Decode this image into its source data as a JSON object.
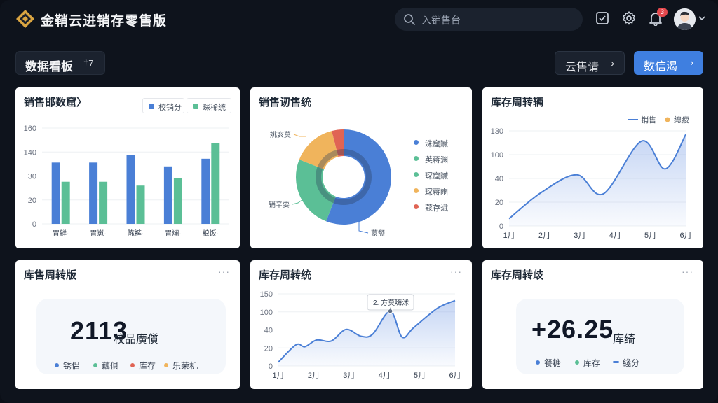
{
  "header": {
    "app_title": "金鞘云进销存零售版",
    "search_placeholder": "入销售台",
    "notification_badge": "3",
    "icons": [
      "logo-icon",
      "search-icon",
      "task-icon",
      "gear-icon",
      "bell-icon",
      "avatar",
      "chevron-down-icon"
    ]
  },
  "toolbar": {
    "board_title": "数据看板",
    "board_count": "†7",
    "btn_secondary": "云售请",
    "btn_primary": "数信渴",
    "arrow": "›"
  },
  "colors": {
    "blue": "#4a7fd6",
    "green": "#5bbf96",
    "orange": "#f0b45c",
    "red": "#e06454",
    "bg": "#0e131c",
    "primary_btn": "#3f7fe0"
  },
  "cards": {
    "sales_bar": {
      "title": "销售邯数窟〉",
      "legend": [
        "校销分",
        "琛稀统"
      ]
    },
    "sales_pie": {
      "title": "销售讱售统",
      "outside_labels": [
        "姚亥莫",
        "销辛要",
        "蒙颓"
      ],
      "legend": [
        "洙窟贓",
        "荚蒋渊",
        "琛窟贓",
        "琛蒋豳",
        "蔻存斌"
      ]
    },
    "stock_line1": {
      "title": "库存周转辆",
      "legend": [
        "销售",
        "總疲"
      ]
    },
    "stock_kpi1": {
      "title": "库售周转版",
      "value": "2113",
      "unit": "校品廣儨",
      "legend": [
        "锈侣",
        "藕俱",
        "库存",
        "乐荣机"
      ]
    },
    "stock_line2": {
      "title": "库存周转统",
      "more": "···",
      "tooltip": "2. 方莫嗨沭"
    },
    "stock_kpi2": {
      "title": "库存周转歧",
      "more": "···",
      "value": "+26.25",
      "unit": "库绮",
      "legend": [
        "餐糖",
        "库存",
        "綫分"
      ]
    }
  },
  "chart_data": [
    {
      "type": "bar",
      "title": "销售邯数窟〉",
      "categories": [
        "胃鲜·",
        "胃崽·",
        "陈裤·",
        "胃斓·",
        "粮饭·"
      ],
      "series": [
        {
          "name": "校销分",
          "values": [
            32,
            32,
            36,
            30,
            34
          ]
        },
        {
          "name": "琛稀统",
          "values": [
            22,
            22,
            20,
            24,
            42
          ]
        }
      ],
      "y_ticks": [
        "0",
        "20",
        "30",
        "140",
        "160"
      ],
      "ylim": [
        0,
        50
      ]
    },
    {
      "type": "pie",
      "title": "销售讱售统",
      "donut": true,
      "slices": [
        {
          "name": "洙窟贓",
          "value": 56
        },
        {
          "name": "荚蒋渊",
          "value": 25
        },
        {
          "name": "琛窟贓",
          "value": 0
        },
        {
          "name": "琛蒋豳",
          "value": 15
        },
        {
          "name": "蔻存斌",
          "value": 4
        }
      ]
    },
    {
      "type": "area",
      "title": "库存周转辆",
      "x": [
        "1月",
        "2月",
        "3月",
        "4月",
        "5月",
        "6月"
      ],
      "y_ticks": [
        "0",
        "20",
        "40",
        "100",
        "130"
      ],
      "ylim": [
        0,
        130
      ],
      "series": [
        {
          "name": "销售",
          "values": [
            10,
            46,
            70,
            44,
            116,
            78,
            125
          ],
          "x_pos": [
            0,
            1.1,
            2.3,
            3.2,
            4.5,
            5.3,
            6
          ]
        }
      ]
    },
    {
      "type": "area",
      "title": "库存周转统",
      "x": [
        "1月",
        "2月",
        "3月",
        "4月",
        "5月",
        "6月"
      ],
      "y_ticks": [
        "0",
        "20",
        "40",
        "100",
        "150"
      ],
      "ylim": [
        0,
        150
      ],
      "series": [
        {
          "values": [
            8,
            44,
            40,
            54,
            52,
            76,
            62,
            66,
            114,
            60,
            80,
            120,
            136
          ],
          "x_pos": [
            0,
            0.6,
            0.9,
            1.3,
            1.8,
            2.3,
            2.8,
            3.2,
            3.8,
            4.2,
            4.6,
            5.4,
            6
          ]
        }
      ],
      "tooltip_point": {
        "x_pos": 3.8,
        "y": 114
      }
    }
  ]
}
